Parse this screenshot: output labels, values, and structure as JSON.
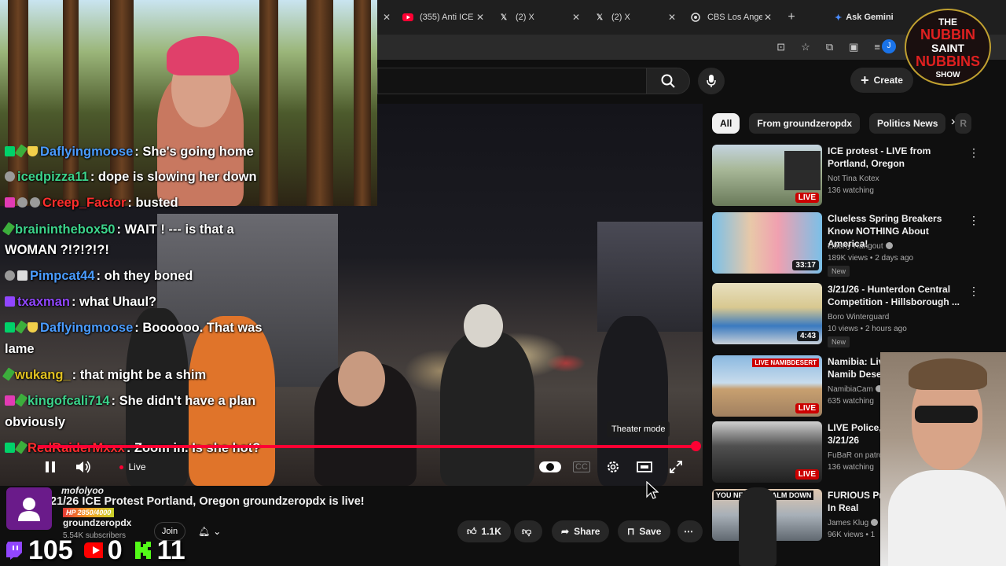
{
  "browser": {
    "tabs": [
      {
        "label": "(355) Anti ICE",
        "icon": "youtube-icon"
      },
      {
        "label": "(2) X",
        "icon": "x-icon"
      },
      {
        "label": "(2) X",
        "icon": "x-icon"
      },
      {
        "label": "CBS Los Ange",
        "icon": "globe-icon"
      }
    ],
    "ask_label": "Ask Gemini",
    "profile_initial": "J"
  },
  "youtube": {
    "create_label": "Create"
  },
  "chat": {
    "messages": [
      {
        "user": "Daflyingmoose",
        "text": ": She's going home",
        "color": "#4a9cff"
      },
      {
        "user": "icedpizza11",
        "text": ": dope is slowing her down",
        "color": "#3cd38b"
      },
      {
        "user": "Creep_Factor",
        "text": ": busted",
        "color": "#ff2d2d"
      },
      {
        "user": "braininthebox50",
        "text": ": WAIT ! --- is that a",
        "color": "#3cd38b"
      },
      {
        "user": "",
        "text": "WOMAN ?!?!?!?!",
        "color": "#ffffff"
      },
      {
        "user": "Pimpcat44",
        "text": ": oh they boned",
        "color": "#4a9cff"
      },
      {
        "user": "txaxman",
        "text": ": what Uhaul?",
        "color": "#9146ff"
      },
      {
        "user": "Daflyingmoose",
        "text": ": Boooooo. That was",
        "color": "#4a9cff"
      },
      {
        "user": "",
        "text": "lame",
        "color": "#ffffff"
      },
      {
        "user": "wukang_",
        "text": ": that might be a shim",
        "color": "#e0c020"
      },
      {
        "user": "kingofcali714",
        "text": ": She didn't have a plan",
        "color": "#3cd38b"
      },
      {
        "user": "",
        "text": "obviously",
        "color": "#ffffff"
      },
      {
        "user": "RedRaiderMxxx",
        "text": ": Zoom in. Is she hot?",
        "color": "#ff2d2d"
      }
    ]
  },
  "player": {
    "tooltip": "Theater mode",
    "live_label": "Live",
    "progress": 1.0
  },
  "video": {
    "title": "21/26 ICE Protest Portland, Oregon groundzeropdx is live!",
    "channel": "groundzeropdx",
    "subscribers": "5.54K subscribers",
    "join_label": "Join",
    "likes": "1.1K",
    "share_label": "Share",
    "save_label": "Save"
  },
  "overlay": {
    "viewer_name": "mofolyoo",
    "hp_label": "HP 2850/4000",
    "counts": {
      "twitch": "105",
      "youtube": "0",
      "kick": "11"
    }
  },
  "sidebar": {
    "chips": [
      "All",
      "From groundzeropdx",
      "Politics News",
      "R"
    ],
    "recommendations": [
      {
        "title": "ICE protest - LIVE from Portland, Oregon",
        "channel": "Not Tina Kotex",
        "meta": "136 watching",
        "badge": "LIVE",
        "new": "",
        "verified": false
      },
      {
        "title": "Clueless Spring Breakers Know NOTHING About America!",
        "channel": "Liberty Hangout",
        "meta": "189K views • 2 days ago",
        "badge": "33:17",
        "new": "New",
        "verified": true
      },
      {
        "title": "3/21/26 - Hunterdon Central Competition - Hillsborough ...",
        "channel": "Boro Winterguard",
        "meta": "10 views • 2 hours ago",
        "badge": "4:43",
        "new": "New",
        "verified": false
      },
      {
        "title": "Namibia: Live stream in the Namib Desert",
        "channel": "NamibiaCam",
        "meta": "635 watching",
        "badge": "LIVE",
        "new": "",
        "verified": true
      },
      {
        "title": "LIVE Police, Fire and EMS 3/21/26",
        "channel": "FuBaR on patroll",
        "meta": "136 watching",
        "badge": "LIVE",
        "new": "",
        "verified": false
      },
      {
        "title": "FURIOUS Protesters Checked In Real",
        "channel": "James Klug",
        "meta": "96K views • 1",
        "badge": "",
        "new": "",
        "verified": true
      }
    ]
  },
  "branding": {
    "logo_text": [
      "THE",
      "NUBBIN",
      "SAINT",
      "NUBBINS",
      "SHOW"
    ],
    "thumb_text_namib": "LIVE NAMIBDESERT",
    "thumb_text_furious": "YOU NEED TO CALM DOWN"
  },
  "colors": {
    "accent_red": "#ff0033",
    "bg": "#0f0f0f",
    "chip_bg": "#272727"
  }
}
